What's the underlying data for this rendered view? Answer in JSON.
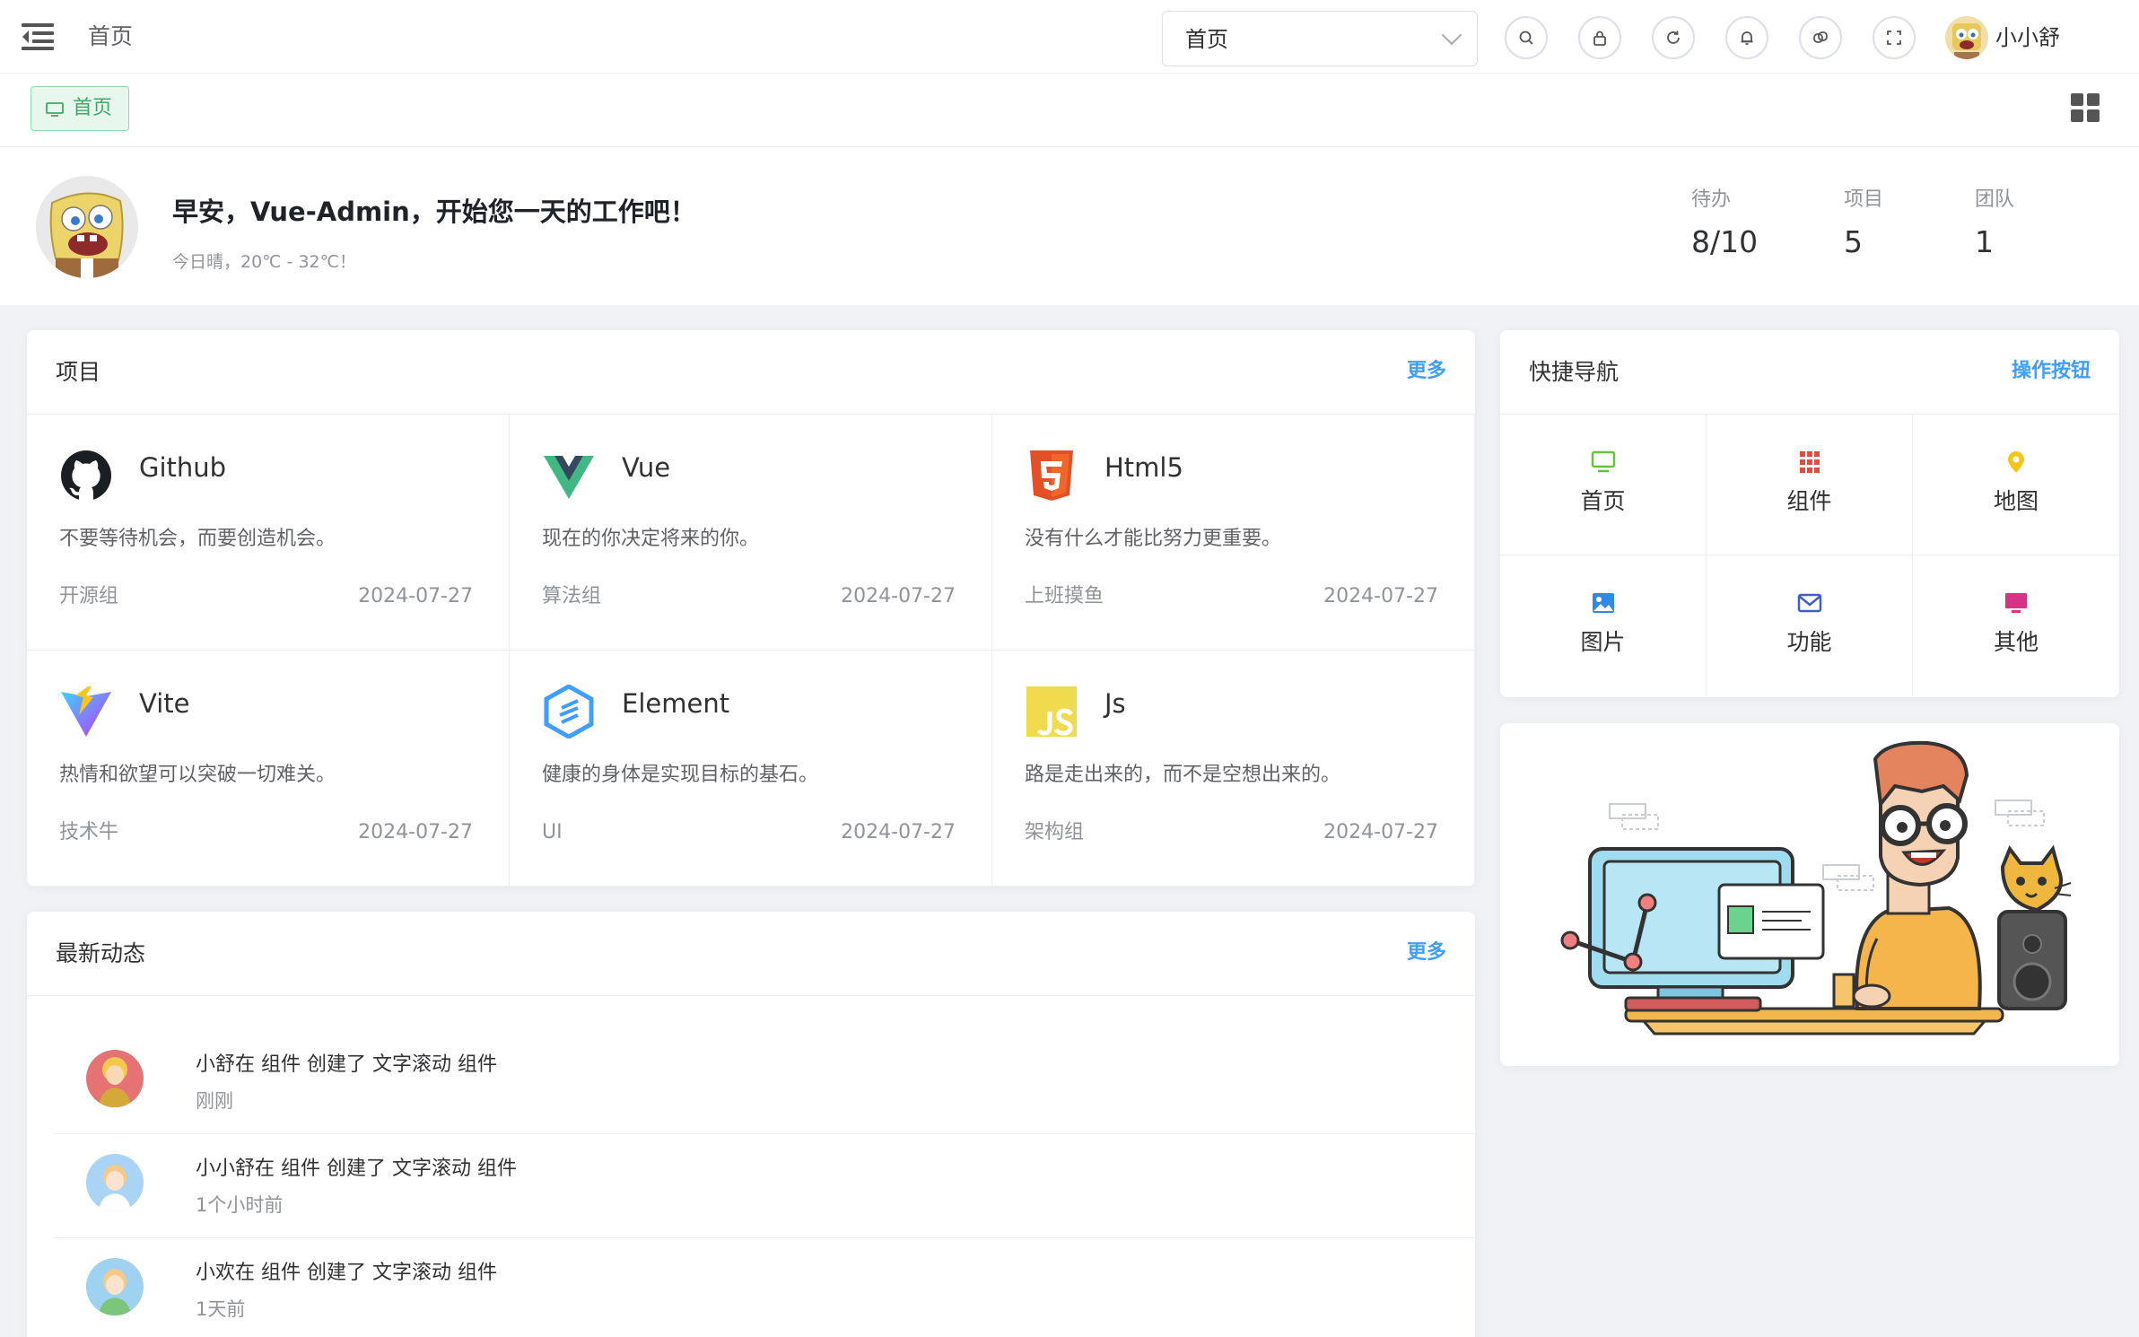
{
  "header": {
    "breadcrumb": "首页",
    "menu_search_value": "首页",
    "username": "小小舒",
    "tools": [
      "search-icon",
      "lock-icon",
      "refresh-icon",
      "bell-icon",
      "theme-icon",
      "fullscreen-icon"
    ]
  },
  "tags": {
    "active_tag": "首页"
  },
  "welcome": {
    "greeting": "早安，Vue-Admin，开始您一天的工作吧！",
    "weather": "今日晴，20℃ - 32℃！",
    "stats": [
      {
        "label": "待办",
        "value": "8/10"
      },
      {
        "label": "项目",
        "value": "5"
      },
      {
        "label": "团队",
        "value": "1"
      }
    ]
  },
  "projects": {
    "title": "项目",
    "more": "更多",
    "items": [
      {
        "name": "Github",
        "desc": "不要等待机会，而要创造机会。",
        "group": "开源组",
        "date": "2024-07-27",
        "icon": "github-icon"
      },
      {
        "name": "Vue",
        "desc": "现在的你决定将来的你。",
        "group": "算法组",
        "date": "2024-07-27",
        "icon": "vue-icon"
      },
      {
        "name": "Html5",
        "desc": "没有什么才能比努力更重要。",
        "group": "上班摸鱼",
        "date": "2024-07-27",
        "icon": "html5-icon"
      },
      {
        "name": "Vite",
        "desc": "热情和欲望可以突破一切难关。",
        "group": "技术牛",
        "date": "2024-07-27",
        "icon": "vite-icon"
      },
      {
        "name": "Element",
        "desc": "健康的身体是实现目标的基石。",
        "group": "UI",
        "date": "2024-07-27",
        "icon": "element-icon"
      },
      {
        "name": "Js",
        "desc": "路是走出来的，而不是空想出来的。",
        "group": "架构组",
        "date": "2024-07-27",
        "icon": "js-icon"
      }
    ]
  },
  "quick_nav": {
    "title": "快捷导航",
    "action": "操作按钮",
    "items": [
      {
        "label": "首页",
        "icon": "monitor-icon",
        "color": "#67c23a"
      },
      {
        "label": "组件",
        "icon": "grid-icon",
        "color": "#f56c6c"
      },
      {
        "label": "地图",
        "icon": "location-icon",
        "color": "#e6a23c"
      },
      {
        "label": "图片",
        "icon": "picture-icon",
        "color": "#409eff"
      },
      {
        "label": "功能",
        "icon": "message-icon",
        "color": "#4569d4"
      },
      {
        "label": "其他",
        "icon": "others-icon",
        "color": "#d63384"
      }
    ]
  },
  "activity": {
    "title": "最新动态",
    "more": "更多",
    "items": [
      {
        "text": "小舒在 组件 创建了 文字滚动 组件",
        "time": "刚刚"
      },
      {
        "text": "小小舒在 组件 创建了 文字滚动 组件",
        "time": "1个小时前"
      },
      {
        "text": "小欢在 组件 创建了 文字滚动 组件",
        "time": "1天前"
      }
    ]
  }
}
